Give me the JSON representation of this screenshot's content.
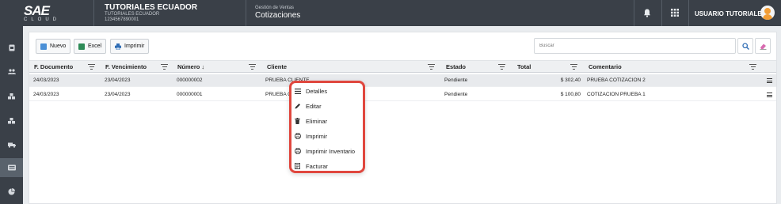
{
  "header": {
    "logo_main": "SAE",
    "logo_sub": "CLOUD",
    "company_name": "TUTORIALES ECUADOR",
    "company_sub": "TUTORIALES ECUADOR",
    "company_id": "1234567890001",
    "module_area": "Gestión de Ventas",
    "module_title": "Cotizaciones",
    "user_name": "USUARIO TUTORIALES",
    "icons": [
      "bell-icon",
      "grid-icon",
      "avatar"
    ]
  },
  "sidebar": {
    "items": [
      {
        "icon": "document-icon"
      },
      {
        "icon": "users-icon"
      },
      {
        "icon": "boxes-icon"
      },
      {
        "icon": "boxes-icon"
      },
      {
        "icon": "truck-icon"
      },
      {
        "icon": "cash-register-icon",
        "active": true
      },
      {
        "icon": "chart-icon"
      }
    ]
  },
  "toolbar": {
    "new_label": "Nuevo",
    "excel_label": "Excel",
    "print_label": "Imprimir",
    "search_placeholder": "Buscar"
  },
  "table": {
    "columns": [
      "F. Documento",
      "F. Vencimiento",
      "Número ↓",
      "Cliente",
      "Estado",
      "Total",
      "Comentario"
    ],
    "rows": [
      {
        "fdoc": "24/03/2023",
        "fven": "23/04/2023",
        "num": "000000002",
        "cliente": "PRUEBA CLIENTE",
        "estado": "Pendiente",
        "total": "$ 302,40",
        "comentario": "PRUEBA COTIZACION 2"
      },
      {
        "fdoc": "24/03/2023",
        "fven": "23/04/2023",
        "num": "000000001",
        "cliente": "PRUEBA C",
        "estado": "Pendiente",
        "total": "$ 100,80",
        "comentario": "COTIZACION PRUEBA 1"
      }
    ]
  },
  "context_menu": {
    "items": [
      "Detalles",
      "Editar",
      "Eliminar",
      "Imprimir",
      "Imprimir Inventario",
      "Facturar"
    ]
  },
  "colors": {
    "topbar": "#3a4048",
    "highlight_border": "#e0473e",
    "avatar": "#f29d35"
  }
}
